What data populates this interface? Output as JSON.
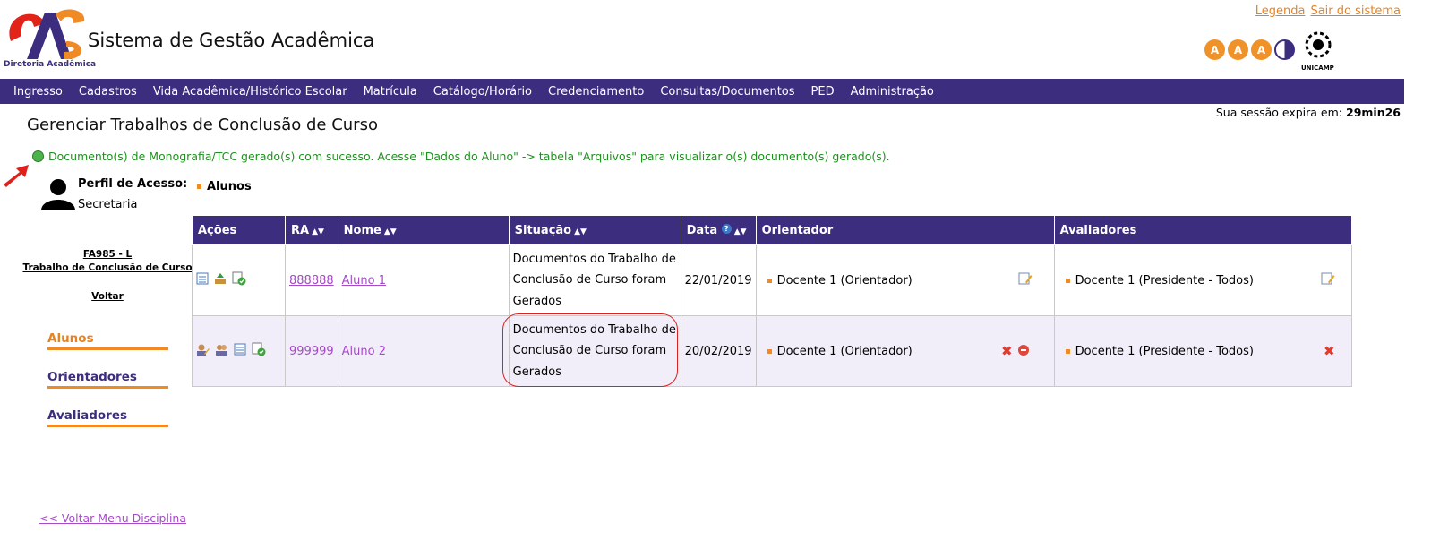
{
  "header": {
    "logo_text": "Diretoria Acadêmica",
    "system_title": "Sistema de Gestão Acadêmica",
    "links": [
      "Legenda",
      "Sair do sistema"
    ],
    "font_buttons": [
      "A",
      "A",
      "A"
    ],
    "unicamp_label": "UNICAMP"
  },
  "menu": [
    "Ingresso",
    "Cadastros",
    "Vida Acadêmica/Histórico Escolar",
    "Matrícula",
    "Catálogo/Horário",
    "Credenciamento",
    "Consultas/Documentos",
    "PED",
    "Administração"
  ],
  "page_title": "Gerenciar Trabalhos de Conclusão de Curso",
  "session": {
    "label": "Sua sessão expira em:",
    "value": "29min26"
  },
  "success_message": "Documento(s) de Monografia/TCC gerado(s) com sucesso. Acesse \"Dados do Aluno\" -> tabela \"Arquivos\" para visualizar o(s) documento(s) gerado(s).",
  "profile": {
    "label": "Perfil de Acesso:",
    "value": "Secretaria"
  },
  "discipline": {
    "code": "FA985 - L",
    "name": "Trabalho de Conclusão de Curso",
    "back": "Voltar"
  },
  "side_nav": [
    "Alunos",
    "Orientadores",
    "Avaliadores"
  ],
  "section": "Alunos",
  "table": {
    "headers": [
      "Ações",
      "RA",
      "Nome",
      "Situação",
      "Data",
      "Orientador",
      "Avaliadores"
    ],
    "rows": [
      {
        "ra": "888888",
        "nome": "Aluno 1",
        "situacao": "Documentos do Trabalho de Conclusão de Curso foram Gerados",
        "data": "22/01/2019",
        "orientador": "Docente 1 (Orientador)",
        "avaliadores": "Docente 1 (Presidente - Todos)"
      },
      {
        "ra": "999999",
        "nome": "Aluno 2",
        "situacao": "Documentos do Trabalho de Conclusão de Curso foram Gerados",
        "data": "20/02/2019",
        "orientador": "Docente 1 (Orientador)",
        "avaliadores": "Docente 1 (Presidente - Todos)"
      }
    ]
  },
  "bottom_link": "<< Voltar Menu Disciplina",
  "colors": {
    "primary": "#3c2d7e",
    "accent": "#f08a24",
    "success": "#1f8f1f",
    "link": "#a64ac9"
  }
}
